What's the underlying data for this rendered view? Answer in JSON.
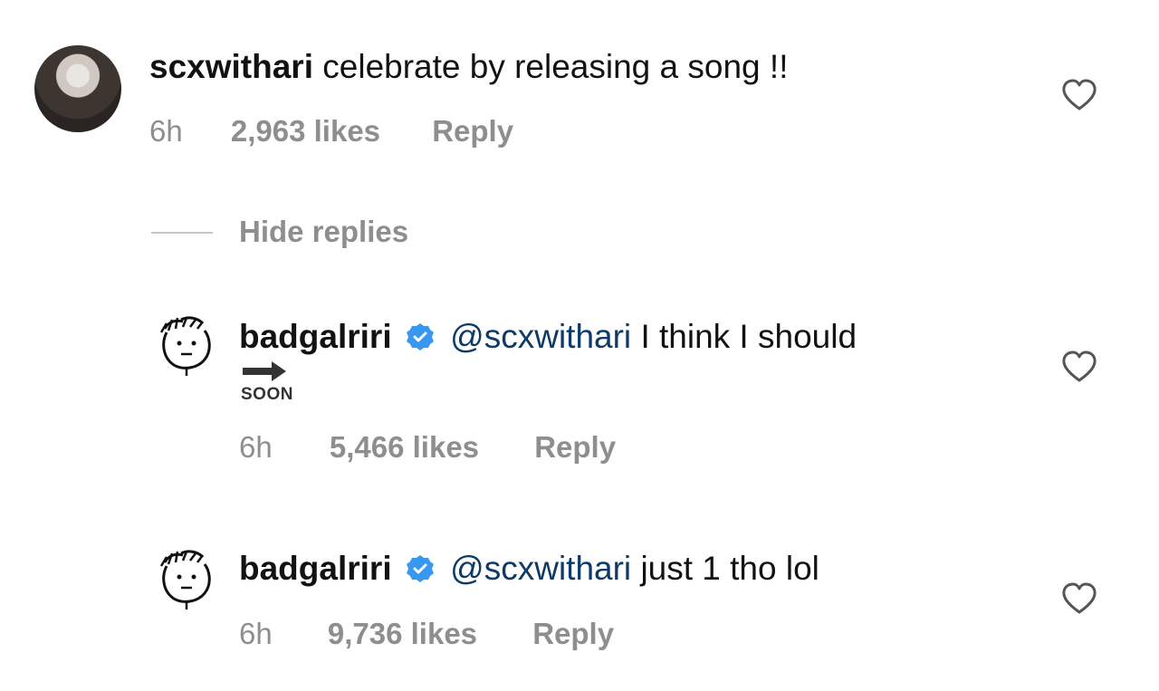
{
  "comment": {
    "username": "scxwithari",
    "text": "celebrate by releasing a song !!",
    "time": "6h",
    "likes": "2,963 likes",
    "reply_label": "Reply",
    "avatar_icon": "profile-photo"
  },
  "hide_replies_label": "Hide replies",
  "replies": [
    {
      "username": "badgalriri",
      "verified": true,
      "mention": "@scxwithari",
      "text": "I think I should",
      "sticker_text": "SOON",
      "time": "6h",
      "likes": "5,466 likes",
      "reply_label": "Reply",
      "avatar_icon": "doodle-face-avatar"
    },
    {
      "username": "badgalriri",
      "verified": true,
      "mention": "@scxwithari",
      "text": "just 1 tho lol",
      "time": "6h",
      "likes": "9,736 likes",
      "reply_label": "Reply",
      "avatar_icon": "doodle-face-avatar"
    }
  ],
  "colors": {
    "text": "#121212",
    "meta": "#8e8e8e",
    "mention": "#0e3a66",
    "verified": "#3897f0",
    "heart_stroke": "#555555"
  }
}
